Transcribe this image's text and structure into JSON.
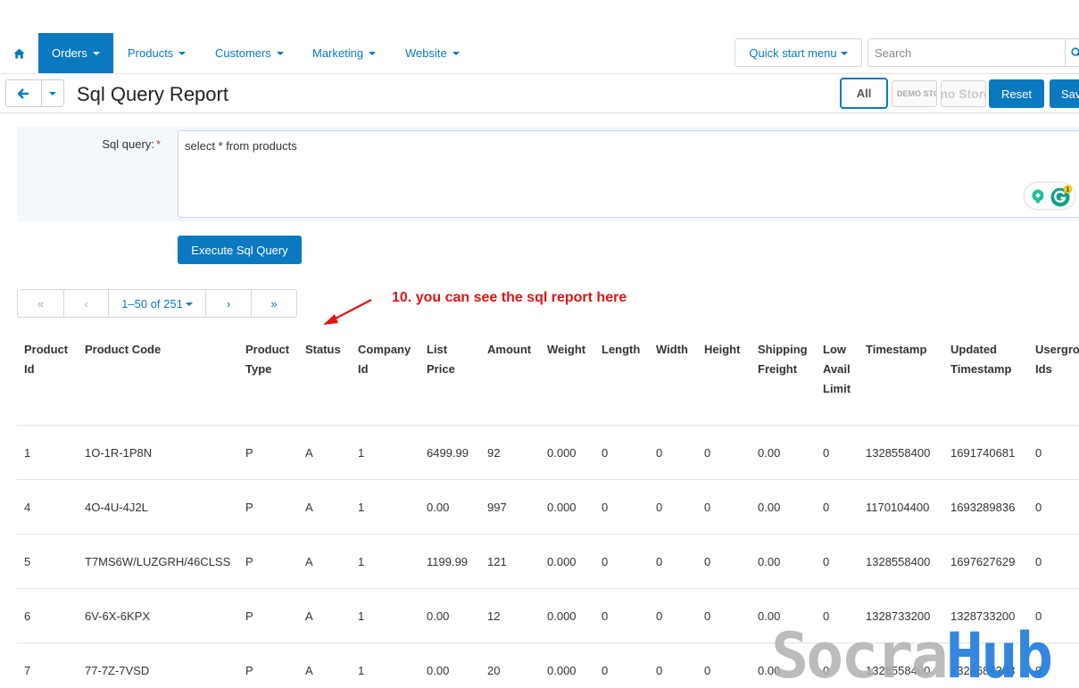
{
  "nav": {
    "home_icon": "home-icon",
    "items": [
      {
        "label": "Orders",
        "active": true
      },
      {
        "label": "Products",
        "active": false
      },
      {
        "label": "Customers",
        "active": false
      },
      {
        "label": "Marketing",
        "active": false
      },
      {
        "label": "Website",
        "active": false
      }
    ],
    "quick_start": "Quick start menu",
    "search_placeholder": "Search"
  },
  "titlebar": {
    "title": "Sql Query Report",
    "all_label": "All",
    "store_a": "DEMO STORE",
    "store_b": "Demo Store",
    "reset_label": "Reset",
    "save_label": "Save"
  },
  "form": {
    "label": "Sql query:",
    "required_mark": "*",
    "query_value": "select * from products",
    "grammarly_count": "1",
    "execute_label": "Execute Sql Query"
  },
  "pagination": {
    "first": "«",
    "prev": "‹",
    "range": "1–50 of 251",
    "next": "›",
    "last": "»"
  },
  "annotation": "10. you can see the sql report here",
  "table": {
    "headers": [
      [
        "Product",
        "Id"
      ],
      [
        "Product Code"
      ],
      [
        "Product",
        "Type"
      ],
      [
        "Status"
      ],
      [
        "Company",
        "Id"
      ],
      [
        "List",
        "Price"
      ],
      [
        "Amount"
      ],
      [
        "Weight"
      ],
      [
        "Length"
      ],
      [
        "Width"
      ],
      [
        "Height"
      ],
      [
        "Shipping",
        "Freight"
      ],
      [
        "Low",
        "Avail",
        "Limit"
      ],
      [
        "Timestamp"
      ],
      [
        "Updated",
        "Timestamp"
      ],
      [
        "Usergroup",
        "Ids"
      ]
    ],
    "rows": [
      [
        "1",
        "1O-1R-1P8N",
        "P",
        "A",
        "1",
        "6499.99",
        "92",
        "0.000",
        "0",
        "0",
        "0",
        "0.00",
        "0",
        "1328558400",
        "1691740681",
        "0"
      ],
      [
        "4",
        "4O-4U-4J2L",
        "P",
        "A",
        "1",
        "0.00",
        "997",
        "0.000",
        "0",
        "0",
        "0",
        "0.00",
        "0",
        "1170104400",
        "1693289836",
        "0"
      ],
      [
        "5",
        "T7MS6W/LUZGRH/46CLSS",
        "P",
        "A",
        "1",
        "1199.99",
        "121",
        "0.000",
        "0",
        "0",
        "0",
        "0.00",
        "0",
        "1328558400",
        "1697627629",
        "0"
      ],
      [
        "6",
        "6V-6X-6KPX",
        "P",
        "A",
        "1",
        "0.00",
        "12",
        "0.000",
        "0",
        "0",
        "0",
        "0.00",
        "0",
        "1328733200",
        "1328733200",
        "0"
      ],
      [
        "7",
        "77-7Z-7VSD",
        "P",
        "A",
        "1",
        "0.00",
        "20",
        "0.000",
        "0",
        "0",
        "0",
        "0.00",
        "0",
        "1328558400",
        "1328684303",
        "0"
      ]
    ]
  },
  "watermark": {
    "part_a": "Socra",
    "part_b": "Hub"
  },
  "colors": {
    "accent": "#0b79c0",
    "annotation": "#e01414",
    "required": "#e53935"
  }
}
